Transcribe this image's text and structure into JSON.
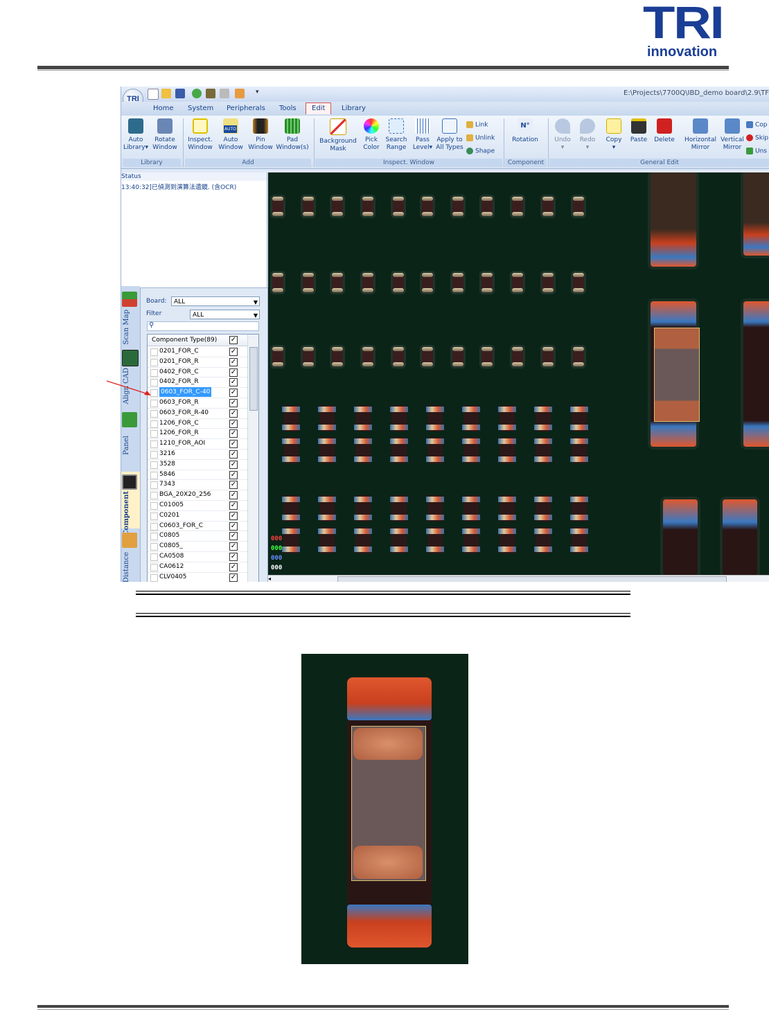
{
  "logo": {
    "brand": "TRI",
    "tagline": "innovation"
  },
  "window": {
    "title": "E:\\Projects\\7700Q\\IBD_demo board\\2.9\\TF"
  },
  "tabs": [
    "Home",
    "System",
    "Peripherals",
    "Tools",
    "Edit",
    "Library"
  ],
  "active_tab": "Edit",
  "ribbon": {
    "library_group": "Library",
    "add_group": "Add",
    "inspect_group": "Inspect. Window",
    "component_group": "Component",
    "general_group": "General Edit",
    "buttons": {
      "auto_library": [
        "Auto",
        "Library▾"
      ],
      "rotate_window": [
        "Rotate",
        "Window"
      ],
      "inspect_window": [
        "Inspect.",
        "Window"
      ],
      "auto_window": [
        "Auto",
        "Window"
      ],
      "pin_window": [
        "Pin",
        "Window"
      ],
      "pad_window": [
        "Pad",
        "Window(s)"
      ],
      "background_mask": [
        "Background",
        "Mask"
      ],
      "pick_color": [
        "Pick",
        "Color"
      ],
      "search_range": [
        "Search",
        "Range"
      ],
      "pass_level": [
        "Pass",
        "Level▾"
      ],
      "apply_all": [
        "Apply to",
        "All Types"
      ],
      "rotation": [
        "Rotation",
        ""
      ],
      "undo": [
        "Undo",
        "▾"
      ],
      "redo": [
        "Redo",
        "▾"
      ],
      "copy": [
        "Copy",
        "▾"
      ],
      "paste": [
        "Paste",
        ""
      ],
      "delete": [
        "Delete",
        ""
      ],
      "horizontal_mirror": [
        "Horizontal",
        "Mirror"
      ],
      "vertical_mirror": [
        "Vertical",
        "Mirror"
      ]
    },
    "small_buttons": {
      "link": "Link",
      "unlink": "Unlink",
      "shape": "Shape",
      "cop": "Cop",
      "skip": "Skip",
      "uns": "Uns"
    },
    "auto_badge": "AUTO",
    "rotation_badge": "N°"
  },
  "status": {
    "header": "Status",
    "message": "13:40:32]已偵測到演算法遺鏡. (含OCR)"
  },
  "side_tabs": [
    "Scan Map",
    "Align CAD",
    "Panel",
    "Component",
    "Distance"
  ],
  "component_panel": {
    "board_label": "Board:",
    "board_value": "ALL",
    "filter_label": "Filter",
    "filter_value": "ALL",
    "list_header": "Component Type(89)",
    "items": [
      {
        "name": "0201_FOR_C",
        "checked": true
      },
      {
        "name": "0201_FOR_R",
        "checked": true
      },
      {
        "name": "0402_FOR_C",
        "checked": true
      },
      {
        "name": "0402_FOR_R",
        "checked": true
      },
      {
        "name": "0603_FOR_C-40",
        "checked": true,
        "selected": true
      },
      {
        "name": "0603_FOR_R",
        "checked": true
      },
      {
        "name": "0603_FOR_R-40",
        "checked": true
      },
      {
        "name": "1206_FOR_C",
        "checked": true
      },
      {
        "name": "1206_FOR_R",
        "checked": true
      },
      {
        "name": "1210_FOR_AOI",
        "checked": true
      },
      {
        "name": "3216",
        "checked": true
      },
      {
        "name": "3528",
        "checked": true
      },
      {
        "name": "5846",
        "checked": true
      },
      {
        "name": "7343",
        "checked": true
      },
      {
        "name": "BGA_20X20_256",
        "checked": true
      },
      {
        "name": "C01005",
        "checked": true
      },
      {
        "name": "C0201",
        "checked": true
      },
      {
        "name": "C0603_FOR_C",
        "checked": true
      },
      {
        "name": "C0805",
        "checked": true
      },
      {
        "name": "C0805_",
        "checked": true
      },
      {
        "name": "CA0508",
        "checked": true
      },
      {
        "name": "CA0612",
        "checked": true
      },
      {
        "name": "CLV0405",
        "checked": true
      }
    ]
  },
  "color_codes": [
    {
      "text": "000",
      "color": "#ff4040"
    },
    {
      "text": "000",
      "color": "#40ff40"
    },
    {
      "text": "000",
      "color": "#6a8cff"
    },
    {
      "text": "000",
      "color": "#ffffff"
    }
  ],
  "colors": {
    "accent": "#1a3e95",
    "ribbon_text": "#15428b",
    "selection": "#3399ff",
    "board": "#0a2418"
  }
}
